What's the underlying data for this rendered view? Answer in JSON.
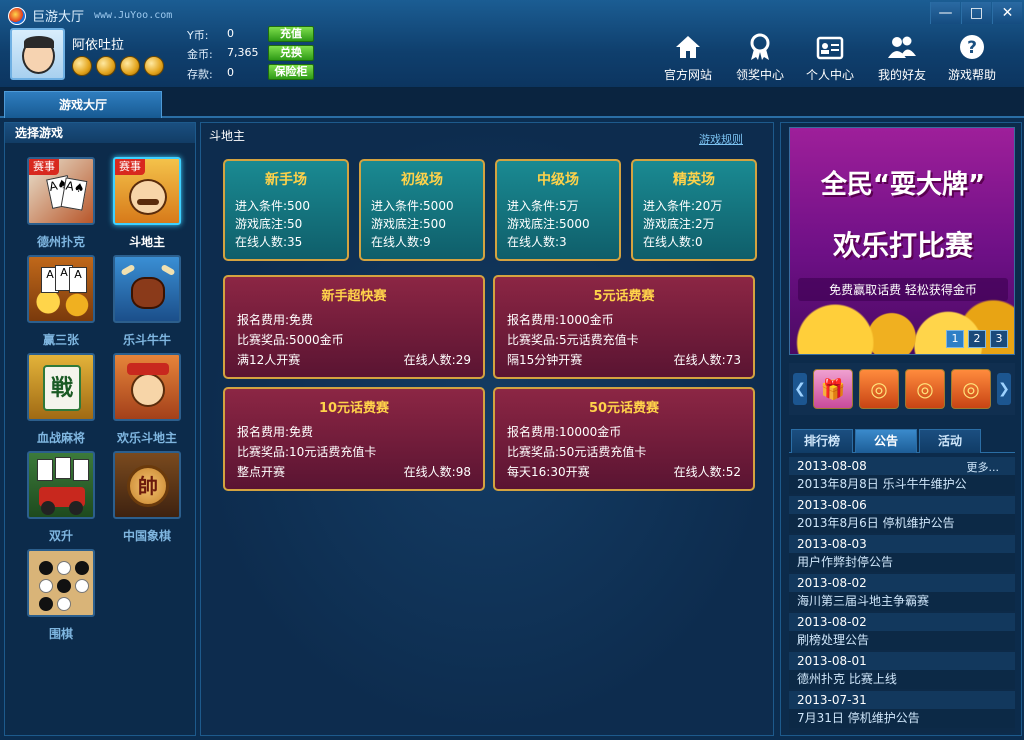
{
  "app": {
    "name": "巨游大厅",
    "url": "www.JuYoo.com"
  },
  "user": {
    "name": "阿依吐拉",
    "medal_count": 4
  },
  "wallet": [
    {
      "label": "Y币:",
      "value": "0",
      "button": "充值"
    },
    {
      "label": "金币:",
      "value": "7,365",
      "button": "兑换"
    },
    {
      "label": "存款:",
      "value": "0",
      "button": "保险柜"
    }
  ],
  "nav": [
    {
      "label": "官方网站",
      "icon": "home-icon"
    },
    {
      "label": "领奖中心",
      "icon": "award-icon"
    },
    {
      "label": "个人中心",
      "icon": "id-card-icon"
    },
    {
      "label": "我的好友",
      "icon": "friends-icon"
    },
    {
      "label": "游戏帮助",
      "icon": "help-icon"
    }
  ],
  "main_tab": "游戏大厅",
  "left": {
    "title": "选择游戏",
    "games": [
      {
        "label": "德州扑克",
        "badge": "赛事"
      },
      {
        "label": "斗地主",
        "badge": "赛事"
      },
      {
        "label": "赢三张",
        "badge": ""
      },
      {
        "label": "乐斗牛牛",
        "badge": ""
      },
      {
        "label": "血战麻将",
        "badge": ""
      },
      {
        "label": "欢乐斗地主",
        "badge": ""
      },
      {
        "label": "双升",
        "badge": ""
      },
      {
        "label": "中国象棋",
        "badge": ""
      },
      {
        "label": "围棋",
        "badge": ""
      }
    ]
  },
  "center": {
    "title": "斗地主",
    "rules_link": "游戏规则",
    "rooms": [
      {
        "title": "新手场",
        "entry": "进入条件:500",
        "bet": "游戏底注:50",
        "online": "在线人数:35"
      },
      {
        "title": "初级场",
        "entry": "进入条件:5000",
        "bet": "游戏底注:500",
        "online": "在线人数:9"
      },
      {
        "title": "中级场",
        "entry": "进入条件:5万",
        "bet": "游戏底注:5000",
        "online": "在线人数:3"
      },
      {
        "title": "精英场",
        "entry": "进入条件:20万",
        "bet": "游戏底注:2万",
        "online": "在线人数:0"
      }
    ],
    "matches": [
      {
        "title": "新手超快赛",
        "fee": "报名费用:免费",
        "prize": "比赛奖品:5000金币",
        "start": "满12人开赛",
        "online": "在线人数:29"
      },
      {
        "title": "5元话费赛",
        "fee": "报名费用:1000金币",
        "prize": "比赛奖品:5元话费充值卡",
        "start": "隔15分钟开赛",
        "online": "在线人数:73"
      },
      {
        "title": "10元话费赛",
        "fee": "报名费用:免费",
        "prize": "比赛奖品:10元话费充值卡",
        "start": "整点开赛",
        "online": "在线人数:98"
      },
      {
        "title": "50元话费赛",
        "fee": "报名费用:10000金币",
        "prize": "比赛奖品:50元话费充值卡",
        "start": "每天16:30开赛",
        "online": "在线人数:52"
      }
    ]
  },
  "banner": {
    "line1": "全民“耍大牌”",
    "line2": "欢乐打比赛",
    "line3": "免费赢取话费 轻松获得金币",
    "pages": [
      "1",
      "2",
      "3"
    ],
    "active_page": "1"
  },
  "right_tabs": [
    "排行榜",
    "公告",
    "活动"
  ],
  "active_right_tab": "公告",
  "notices_more": "更多...",
  "notices": [
    {
      "date": "2013-08-08",
      "text": "2013年8月8日 乐斗牛牛维护公"
    },
    {
      "date": "2013-08-06",
      "text": "2013年8月6日 停机维护公告"
    },
    {
      "date": "2013-08-03",
      "text": "用户作弊封停公告"
    },
    {
      "date": "2013-08-02",
      "text": "海川第三届斗地主争霸赛"
    },
    {
      "date": "2013-08-02",
      "text": "刷榜处理公告"
    },
    {
      "date": "2013-08-01",
      "text": "德州扑克 比赛上线"
    },
    {
      "date": "2013-07-31",
      "text": "7月31日 停机维护公告"
    }
  ],
  "colors": {
    "accent": "#3ed1ff",
    "room_bg": "#1a8a92",
    "match_bg": "#8c2644",
    "gold": "#ffd24a"
  }
}
